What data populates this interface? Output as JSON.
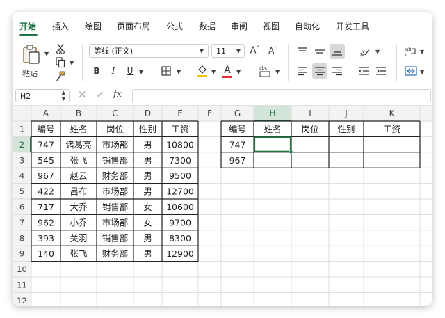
{
  "tabs": [
    "开始",
    "插入",
    "绘图",
    "页面布局",
    "公式",
    "数据",
    "审阅",
    "视图",
    "自动化",
    "开发工具"
  ],
  "ribbon": {
    "paste_label": "粘贴",
    "font_name": "等线 (正文)",
    "font_size": "11",
    "bold": "B",
    "italic": "I",
    "underline": "U",
    "font_color_letter": "A",
    "grow_font": "A^",
    "shrink_font": "Aˇ",
    "font_color": "#e03030",
    "fill_color": "#f5c400"
  },
  "formula_bar": {
    "name_box": "H2",
    "fx": "fx",
    "value": ""
  },
  "columns": [
    "A",
    "B",
    "C",
    "D",
    "E",
    "F",
    "G",
    "H",
    "I",
    "J",
    "K"
  ],
  "rows": [
    "1",
    "2",
    "3",
    "4",
    "5",
    "6",
    "7",
    "8",
    "9",
    "10",
    "11",
    "12"
  ],
  "active_cell": "H2",
  "table1": {
    "headers": [
      "编号",
      "姓名",
      "岗位",
      "性别",
      "工资"
    ],
    "rows": [
      [
        "747",
        "诸葛亮",
        "市场部",
        "男",
        "10800"
      ],
      [
        "545",
        "张飞",
        "销售部",
        "男",
        "7300"
      ],
      [
        "967",
        "赵云",
        "财务部",
        "男",
        "9500"
      ],
      [
        "422",
        "吕布",
        "市场部",
        "男",
        "12700"
      ],
      [
        "717",
        "大乔",
        "销售部",
        "女",
        "10600"
      ],
      [
        "962",
        "小乔",
        "市场部",
        "女",
        "9700"
      ],
      [
        "393",
        "关羽",
        "销售部",
        "男",
        "8300"
      ],
      [
        "140",
        "张飞",
        "财务部",
        "男",
        "12900"
      ]
    ]
  },
  "table2": {
    "headers": [
      "编号",
      "姓名",
      "岗位",
      "性别",
      "工资"
    ],
    "rows": [
      [
        "747",
        "",
        "",
        "",
        ""
      ],
      [
        "967",
        "",
        "",
        "",
        ""
      ]
    ]
  },
  "colors": {
    "accent_green": "#1f7244",
    "header_bg": "#f3f3f3",
    "selected_header_bg": "#d3e5d9"
  }
}
